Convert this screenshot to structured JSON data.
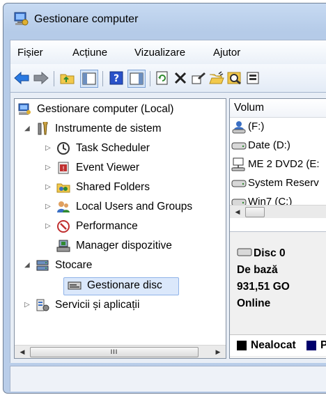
{
  "window": {
    "title": "Gestionare computer"
  },
  "menu": [
    "Fișier",
    "Acțiune",
    "Vizualizare",
    "Ajutor"
  ],
  "tree": {
    "root": "Gestionare computer (Local)",
    "system_tools": "Instrumente de sistem",
    "task_scheduler": "Task Scheduler",
    "event_viewer": "Event Viewer",
    "shared_folders": "Shared Folders",
    "local_users": "Local Users and Groups",
    "performance": "Performance",
    "device_manager": "Manager dispozitive",
    "storage": "Stocare",
    "disk_management": "Gestionare disc",
    "services": "Servicii și aplicații",
    "scroll_thumb": "III"
  },
  "volumes": {
    "header": "Volum",
    "rows": [
      "(F:)",
      "Date (D:)",
      "ME 2 DVD2 (E:",
      "System Reserv",
      "Win7 (C:)"
    ]
  },
  "disk": {
    "name": "Disc 0",
    "type": "De bază",
    "size": "931,51 GO",
    "status": "Online"
  },
  "legend": {
    "unallocated": "Nealocat",
    "primary_partial": "P"
  },
  "colors": {
    "selection_bg": "#dbe8fb",
    "selection_border": "#8fb2e8",
    "unallocated": "#000000",
    "primary": "#00006b"
  }
}
